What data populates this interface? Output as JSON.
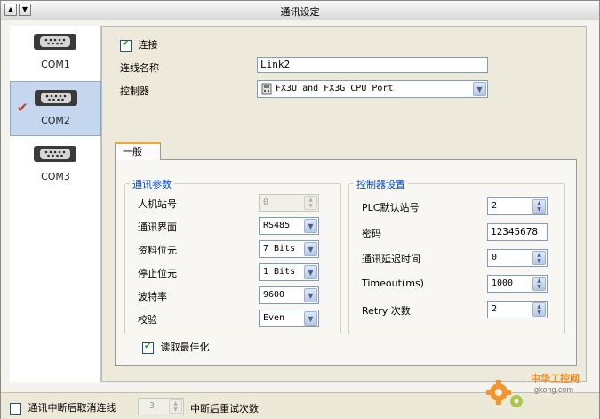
{
  "window": {
    "title": "通讯设定"
  },
  "sidebar": {
    "items": [
      {
        "label": "COM1",
        "selected": false
      },
      {
        "label": "COM2",
        "selected": true
      },
      {
        "label": "COM3",
        "selected": false
      }
    ]
  },
  "connection": {
    "connect_label": "连接",
    "connect_checked": true,
    "name_label": "连线名称",
    "name_value": "Link2",
    "controller_label": "控制器",
    "controller_value": "FX3U and FX3G CPU Port"
  },
  "tabs": [
    {
      "label": "一般"
    }
  ],
  "comm_params": {
    "title": "通讯参数",
    "hmi_station_label": "人机站号",
    "hmi_station_value": "0",
    "interface_label": "通讯界面",
    "interface_value": "RS485",
    "data_bits_label": "资料位元",
    "data_bits_value": "7 Bits",
    "stop_bits_label": "停止位元",
    "stop_bits_value": "1 Bits",
    "baud_label": "波特率",
    "baud_value": "9600",
    "parity_label": "校验",
    "parity_value": "Even",
    "optimize_label": "读取最佳化",
    "optimize_checked": true
  },
  "controller_settings": {
    "title": "控制器设置",
    "plc_station_label": "PLC默认站号",
    "plc_station_value": "2",
    "password_label": "密码",
    "password_value": "12345678",
    "delay_label": "通讯延迟时间",
    "delay_value": "0",
    "timeout_label": "Timeout(ms)",
    "timeout_value": "1000",
    "retry_label": "Retry 次数",
    "retry_value": "2"
  },
  "footer": {
    "cancel_label": "通讯中断后取消连线",
    "cancel_checked": false,
    "retry_count_value": "3",
    "retry_label": "中断后重试次数"
  },
  "watermark": {
    "brand": "中华工控网",
    "domain": "gkong.com"
  },
  "colors": {
    "accent_blue": "#0046d5",
    "selected_bg": "#c5d7ee",
    "tab_highlight": "#f0a830",
    "check_green": "#21a121",
    "watermark_orange": "#f28c1c"
  }
}
